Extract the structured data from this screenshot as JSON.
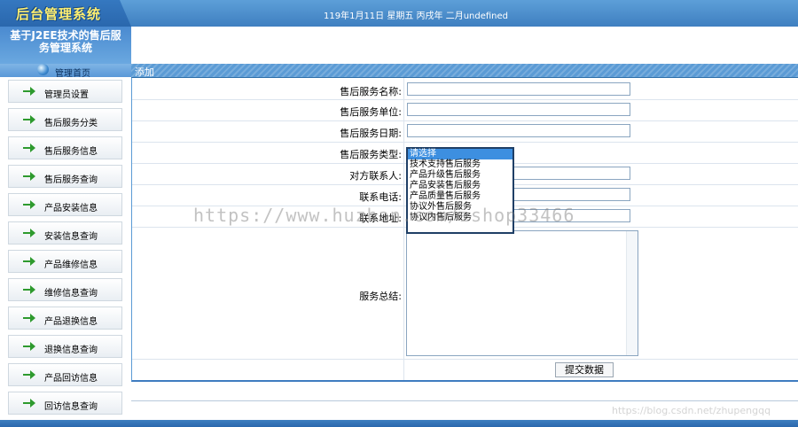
{
  "header": {
    "logo": "后台管理系统",
    "date_line": "119年1月11日 星期五 丙戌年 二月undefined"
  },
  "left_header": {
    "title_line1": "基于J2EE技术的售后服",
    "title_line2": "务管理系统",
    "home_label": "管理首页"
  },
  "sidebar": {
    "items": [
      {
        "label": "管理员设置"
      },
      {
        "label": "售后服务分类"
      },
      {
        "label": "售后服务信息"
      },
      {
        "label": "售后服务查询"
      },
      {
        "label": "产品安装信息"
      },
      {
        "label": "安装信息查询"
      },
      {
        "label": "产品维修信息"
      },
      {
        "label": "维修信息查询"
      },
      {
        "label": "产品退换信息"
      },
      {
        "label": "退换信息查询"
      },
      {
        "label": "产品回访信息"
      },
      {
        "label": "回访信息查询"
      }
    ]
  },
  "panel": {
    "title": "添加"
  },
  "form": {
    "name_label": "售后服务名称:",
    "unit_label": "售后服务单位:",
    "date_label": "售后服务日期:",
    "type_label": "售后服务类型:",
    "contact_label": "对方联系人:",
    "phone_label": "联系电话:",
    "addr_label": "联系地址:",
    "summary_label": "服务总结:",
    "name_value": "",
    "unit_value": "",
    "date_value": "",
    "contact_value": "",
    "phone_value": "",
    "addr_value": "",
    "summary_value": "",
    "type_options": [
      "请选择",
      "技术支持售后服务",
      "产品升级售后服务",
      "产品安装售后服务",
      "产品质量售后服务",
      "协议外售后服务",
      "协议内售后服务"
    ],
    "submit_label": "提交数据"
  },
  "watermarks": {
    "url": "https://www.huzhan.com/ishop33466",
    "csdn": "https://blog.csdn.net/zhupengqq"
  },
  "colors": {
    "header_blue": "#4a8ad0",
    "panel_head": "#5b9bd5",
    "arrow_green": "#2e9a2e",
    "logo_yellow": "#ffef70"
  }
}
